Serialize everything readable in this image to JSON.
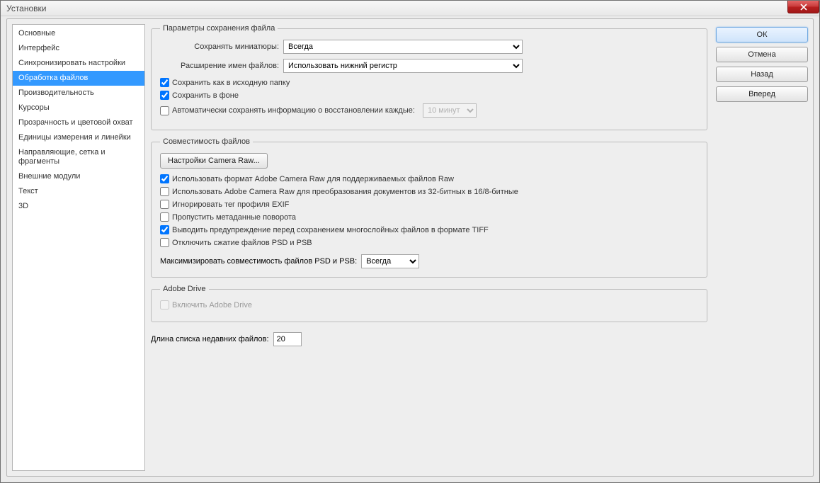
{
  "window": {
    "title": "Установки"
  },
  "sidebar": {
    "items": [
      "Основные",
      "Интерфейс",
      "Синхронизировать настройки",
      "Обработка файлов",
      "Производительность",
      "Курсоры",
      "Прозрачность и цветовой охват",
      "Единицы измерения и линейки",
      "Направляющие, сетка и фрагменты",
      "Внешние модули",
      "Текст",
      "3D"
    ],
    "selected_index": 3
  },
  "buttons": {
    "ok": "ОК",
    "cancel": "Отмена",
    "back": "Назад",
    "forward": "Вперед"
  },
  "file_save": {
    "legend": "Параметры сохранения файла",
    "thumbs_label": "Сохранять миниатюры:",
    "thumbs_value": "Всегда",
    "ext_label": "Расширение имен файлов:",
    "ext_value": "Использовать нижний регистр",
    "save_original": {
      "label": "Сохранить как в исходную папку",
      "checked": true
    },
    "save_background": {
      "label": "Сохранить в фоне",
      "checked": true
    },
    "auto_save": {
      "label": "Автоматически сохранять информацию о восстановлении каждые:",
      "checked": false,
      "interval": "10 минут"
    }
  },
  "compat": {
    "legend": "Совместимость файлов",
    "camera_raw_btn": "Настройки Camera Raw...",
    "use_acr_raw": {
      "label": "Использовать формат Adobe Camera Raw для поддерживаемых файлов Raw",
      "checked": true
    },
    "use_acr_32": {
      "label": "Использовать Adobe Camera Raw для преобразования документов из 32-битных в 16/8-битные",
      "checked": false
    },
    "ignore_exif": {
      "label": "Игнорировать тег профиля EXIF",
      "checked": false
    },
    "skip_rot": {
      "label": "Пропустить метаданные поворота",
      "checked": false
    },
    "tiff_warn": {
      "label": "Выводить предупреждение перед сохранением многослойных файлов в формате TIFF",
      "checked": true
    },
    "disable_psd": {
      "label": "Отключить сжатие файлов PSD и PSB",
      "checked": false
    },
    "maximize_label": "Максимизировать совместимость файлов PSD и PSB:",
    "maximize_value": "Всегда"
  },
  "drive": {
    "legend": "Adobe Drive",
    "enable": {
      "label": "Включить Adobe Drive",
      "checked": false,
      "disabled": true
    }
  },
  "recent": {
    "label": "Длина списка недавних файлов:",
    "value": "20"
  }
}
